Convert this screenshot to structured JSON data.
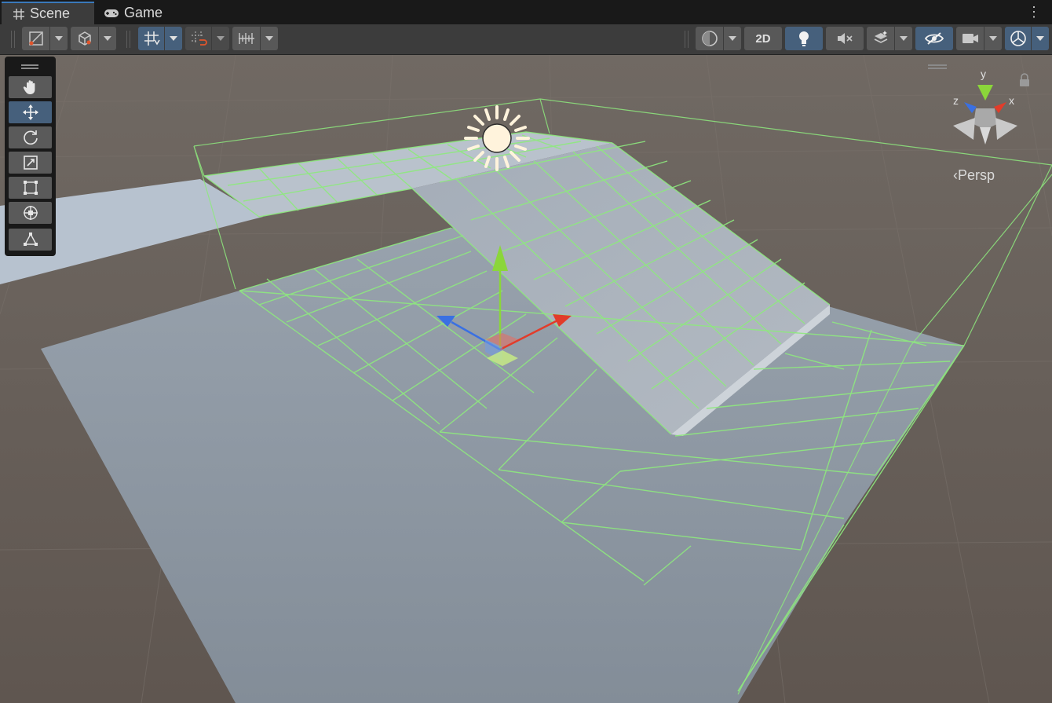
{
  "tabs": {
    "scene": "Scene",
    "game": "Game"
  },
  "tab_menu_icon": "kebab-menu-icon",
  "toolbar": {
    "left": [
      {
        "name": "draw-mode-icon",
        "has_dropdown": true,
        "active": false
      },
      {
        "name": "view-cube-icon",
        "has_dropdown": true,
        "active": false
      },
      {
        "name": "grid-snap-icon",
        "has_dropdown": true,
        "active": true
      },
      {
        "name": "increment-snap-icon",
        "has_dropdown": true,
        "active": false
      },
      {
        "name": "ruler-icon",
        "has_dropdown": true,
        "active": false
      }
    ],
    "right": [
      {
        "name": "shading-sphere-icon",
        "has_dropdown": true,
        "active": false
      },
      {
        "name": "2d-toggle",
        "label": "2D",
        "active": false
      },
      {
        "name": "lighting-bulb-icon",
        "active": true
      },
      {
        "name": "audio-mute-icon",
        "active": false
      },
      {
        "name": "effects-layers-icon",
        "has_dropdown": true,
        "active": false
      },
      {
        "name": "scene-visibility-icon",
        "active": true
      },
      {
        "name": "scene-camera-icon",
        "has_dropdown": true,
        "active": false
      },
      {
        "name": "gizmos-icon",
        "has_dropdown": true,
        "active": true
      }
    ]
  },
  "tools": [
    {
      "name": "hand-tool",
      "icon": "hand-icon",
      "active": false
    },
    {
      "name": "move-tool",
      "icon": "move-arrows-icon",
      "active": true
    },
    {
      "name": "rotate-tool",
      "icon": "rotate-icon",
      "active": false
    },
    {
      "name": "scale-tool",
      "icon": "scale-icon",
      "active": false
    },
    {
      "name": "rect-tool",
      "icon": "rect-icon",
      "active": false
    },
    {
      "name": "transform-tool",
      "icon": "transform-icon",
      "active": false
    },
    {
      "name": "custom-tool",
      "icon": "custom-editor-tool-icon",
      "active": false
    }
  ],
  "gizmo": {
    "axes": {
      "y": "y",
      "z": "z",
      "x": "x"
    },
    "projection": "Persp"
  },
  "colors": {
    "tab_accent": "#3a79bb",
    "active_button": "#46607c",
    "background": "#6b625c",
    "wireframe": "#8ee97e",
    "axis_x": "#e23c2a",
    "axis_y": "#8bd63a",
    "axis_z": "#3a70e2"
  }
}
